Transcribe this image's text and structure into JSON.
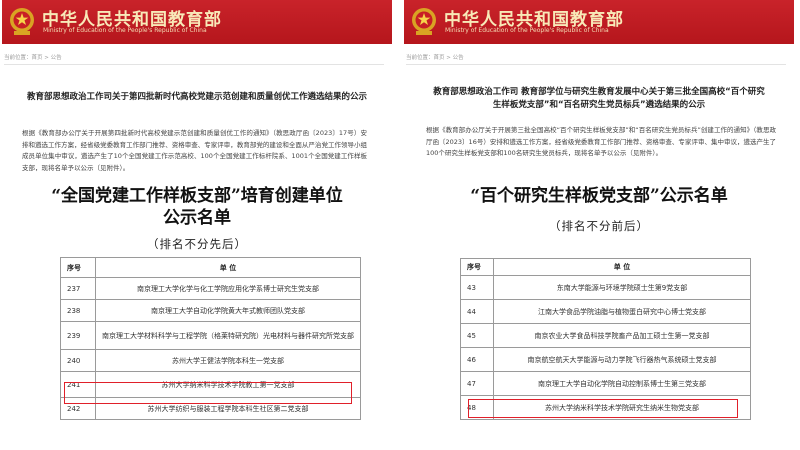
{
  "site": {
    "name_cn": "中华人民共和国教育部",
    "name_en": "Ministry of Education of the People's Republic of China"
  },
  "left": {
    "breadcrumb": "当前位置：首页 > 公告",
    "doc_title": "教育部思想政治工作司关于第四批新时代高校党建示范创建和质量创优工作遴选结果的公示",
    "doc_body": "根据《教育部办公厅关于开展第四批新时代高校党建示范创建和质量创优工作的通知》（教思政厅函〔2023〕17号）安排和遴选工作方案，经省级党委教育工作部门推荐、资格审查、专家评审，教育部党的建设和全面从严治党工作领导小组成员单位集中审议，遴选产生了10个全国党建工作示范高校、100个全国党建工作标杆院系、1001个全国党建工作样板支部，现将名单予以公示（见附件）。",
    "list_title_line1": "“全国党建工作样板支部”培育创建单位",
    "list_title_line2": "公示名单",
    "note": "（排名不分先后）",
    "table": {
      "col_num": "序号",
      "col_unit": "单 位",
      "rows": [
        {
          "num": "237",
          "unit": "南京理工大学化学与化工学院应用化学系博士研究生党支部"
        },
        {
          "num": "238",
          "unit": "南京理工大学自动化学院黄大年式教师团队党支部"
        },
        {
          "num": "239",
          "unit": "南京理工大学材料科学与工程学院（格莱特研究院）光电材料与器件研究所党支部"
        },
        {
          "num": "240",
          "unit": "苏州大学王健法学院本科生一党支部"
        },
        {
          "num": "241",
          "unit": "苏州大学纳米科学技术学院教工第一党支部"
        },
        {
          "num": "242",
          "unit": "苏州大学纺织与服装工程学院本科生社区第二党支部"
        }
      ]
    }
  },
  "right": {
    "breadcrumb": "当前位置：首页 > 公告",
    "doc_title_line1": "教育部思想政治工作司 教育部学位与研究生教育发展中心关于第三批全国高校“百个研究",
    "doc_title_line2": "生样板党支部”和“百名研究生党员标兵”遴选结果的公示",
    "doc_body": "根据《教育部办公厅关于开展第三批全国高校“百个研究生样板党支部”和“百名研究生党员标兵”创建工作的通知》（教思政厅函〔2023〕16号）安排和遴选工作方案，经省级党委教育工作部门推荐、资格审查、专家评审、集中审议，遴选产生了100个研究生样板党支部和100名研究生党员标兵，现将名单予以公示（见附件）。",
    "list_title": "“百个研究生样板党支部”公示名单",
    "note": "（排名不分前后）",
    "table": {
      "col_num": "序号",
      "col_unit": "单 位",
      "rows": [
        {
          "num": "43",
          "unit": "东南大学能源与环境学院硕士生第9党支部"
        },
        {
          "num": "44",
          "unit": "江南大学食品学院油脂与植物蛋白研究中心博士党支部"
        },
        {
          "num": "45",
          "unit": "南京农业大学食品科技学院畜产品加工硕士生第一党支部"
        },
        {
          "num": "46",
          "unit": "南京航空航天大学能源与动力学院飞行器热气系统硕士党支部"
        },
        {
          "num": "47",
          "unit": "南京理工大学自动化学院自动控制系博士生第三党支部"
        },
        {
          "num": "48",
          "unit": "苏州大学纳米科学技术学院研究生纳米生物党支部"
        }
      ]
    }
  }
}
